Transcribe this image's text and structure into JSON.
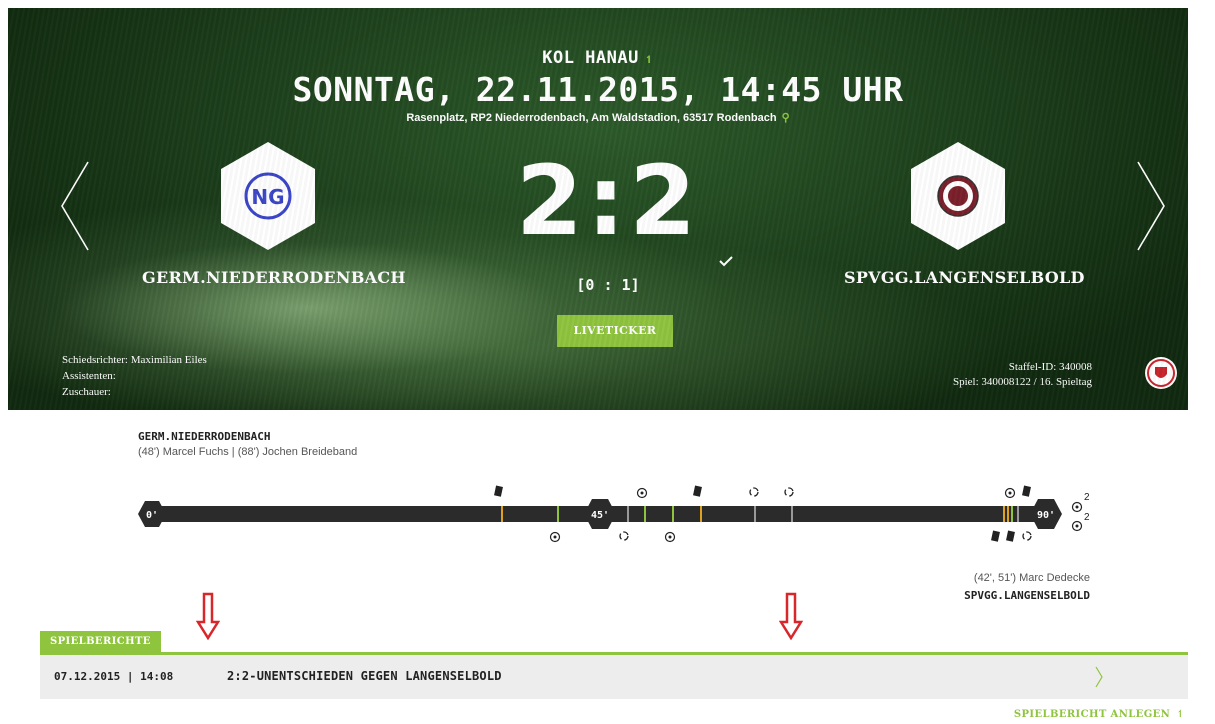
{
  "match": {
    "competition": "KOL HANAU",
    "competition_link_icon": "↿",
    "datetime": "SONNTAG, 22.11.2015, 14:45 UHR",
    "venue": "Rasenplatz, RP2 Niederrodenbach, Am Waldstadion, 63517 Rodenbach",
    "home_team": "GERM.NIEDERRODENBACH",
    "away_team": "SPVGG.LANGENSELBOLD",
    "score": "2:2",
    "halftime": "[0 : 1]",
    "liveticker_label": "LIVETICKER"
  },
  "officials": {
    "referee": "Schiedsrichter: Maximilian Eiles",
    "assistants": "Assistenten:",
    "spectators": "Zuschauer:"
  },
  "meta": {
    "staffel": "Staffel-ID: 340008",
    "spiel": "Spiel: 340008122 / 16. Spieltag"
  },
  "timeline": {
    "home_label": "GERM.NIEDERRODENBACH",
    "home_scorers": "(48') Marcel Fuchs | (88') Jochen Breideband",
    "away_scorers": "(42', 51') Marc Dedecke",
    "away_label": "SPVGG.LANGENSELBOLD",
    "markers": [
      "0'",
      "45'",
      "90'"
    ],
    "extra_goals_home": "2",
    "extra_goals_away": "2"
  },
  "reports": {
    "tab_label": "SPIELBERICHTE",
    "items": [
      {
        "date": "07.12.2015 | 14:08",
        "title": "2:2-UNENTSCHIEDEN GEGEN LANGENSELBOLD"
      }
    ],
    "create_label": "SPIELBERICHT ANLEGEN",
    "create_icon": "↿"
  },
  "colors": {
    "accent": "#8fc43e",
    "timeline_bar": "#2b2b2b",
    "arrow_red": "#d8262b"
  }
}
